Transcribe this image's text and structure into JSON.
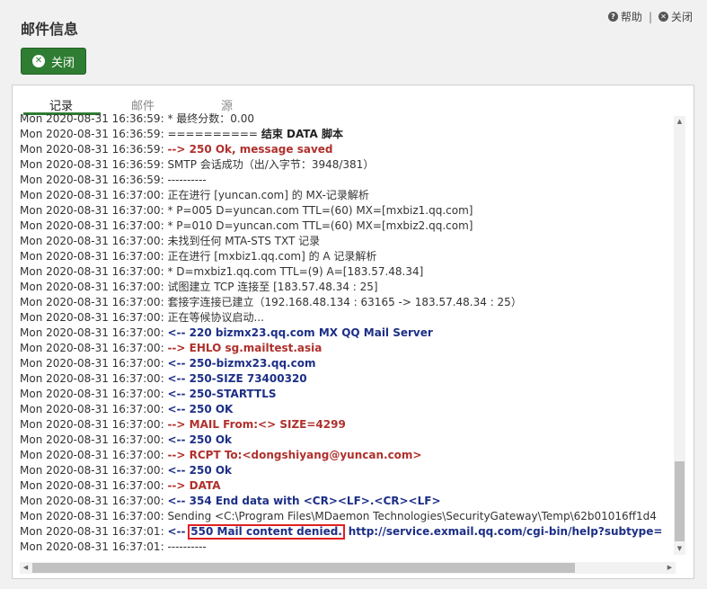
{
  "dialog": {
    "title": "邮件信息"
  },
  "top_links": {
    "help": "帮助",
    "close": "关闭",
    "separator": "|"
  },
  "close_button": {
    "label": "关闭"
  },
  "tabs": [
    {
      "label": "记录",
      "active": true
    },
    {
      "label": "邮件",
      "active": false
    },
    {
      "label": "源",
      "active": false
    }
  ],
  "log_lines": [
    {
      "time": "Mon 2020-08-31 16:36:59:",
      "msg": "* 最终分数：0.00",
      "style": "plain"
    },
    {
      "time": "Mon 2020-08-31 16:36:59:",
      "msg": "==========",
      "extra": "结束 DATA 脚本",
      "style": "mixed"
    },
    {
      "time": "Mon 2020-08-31 16:36:59:",
      "msg": "--> 250 Ok, message saved",
      "style": "out"
    },
    {
      "time": "Mon 2020-08-31 16:36:59:",
      "msg": "SMTP 会话成功（出/入字节：3948/381）",
      "style": "plain"
    },
    {
      "time": "Mon 2020-08-31 16:36:59:",
      "msg": "----------",
      "style": "plain"
    },
    {
      "time": "Mon 2020-08-31 16:37:00:",
      "msg": "正在进行 [yuncan.com] 的 MX-记录解析",
      "style": "plain"
    },
    {
      "time": "Mon 2020-08-31 16:37:00:",
      "msg": "* P=005 D=yuncan.com TTL=(60) MX=[mxbiz1.qq.com]",
      "style": "plain"
    },
    {
      "time": "Mon 2020-08-31 16:37:00:",
      "msg": "* P=010 D=yuncan.com TTL=(60) MX=[mxbiz2.qq.com]",
      "style": "plain"
    },
    {
      "time": "Mon 2020-08-31 16:37:00:",
      "msg": "未找到任何 MTA-STS TXT 记录",
      "style": "plain"
    },
    {
      "time": "Mon 2020-08-31 16:37:00:",
      "msg": "正在进行 [mxbiz1.qq.com] 的 A 记录解析",
      "style": "plain"
    },
    {
      "time": "Mon 2020-08-31 16:37:00:",
      "msg": "* D=mxbiz1.qq.com TTL=(9) A=[183.57.48.34]",
      "style": "plain"
    },
    {
      "time": "Mon 2020-08-31 16:37:00:",
      "msg": "试图建立 TCP 连接至 [183.57.48.34 : 25]",
      "style": "plain"
    },
    {
      "time": "Mon 2020-08-31 16:37:00:",
      "msg": "套接字连接已建立（192.168.48.134 : 63165 -> 183.57.48.34 : 25）",
      "style": "plain"
    },
    {
      "time": "Mon 2020-08-31 16:37:00:",
      "msg": "正在等候协议启动...",
      "style": "plain"
    },
    {
      "time": "Mon 2020-08-31 16:37:00:",
      "msg": "<-- 220 bizmx23.qq.com MX QQ Mail Server",
      "style": "in"
    },
    {
      "time": "Mon 2020-08-31 16:37:00:",
      "msg": "--> EHLO sg.mailtest.asia",
      "style": "out"
    },
    {
      "time": "Mon 2020-08-31 16:37:00:",
      "msg": "<-- 250-bizmx23.qq.com",
      "style": "in"
    },
    {
      "time": "Mon 2020-08-31 16:37:00:",
      "msg": "<-- 250-SIZE 73400320",
      "style": "in"
    },
    {
      "time": "Mon 2020-08-31 16:37:00:",
      "msg": "<-- 250-STARTTLS",
      "style": "in"
    },
    {
      "time": "Mon 2020-08-31 16:37:00:",
      "msg": "<-- 250 OK",
      "style": "in"
    },
    {
      "time": "Mon 2020-08-31 16:37:00:",
      "msg": "--> MAIL From:<> SIZE=4299",
      "style": "out"
    },
    {
      "time": "Mon 2020-08-31 16:37:00:",
      "msg": "<-- 250 Ok",
      "style": "in"
    },
    {
      "time": "Mon 2020-08-31 16:37:00:",
      "msg": "--> RCPT To:<dongshiyang@yuncan.com>",
      "style": "out"
    },
    {
      "time": "Mon 2020-08-31 16:37:00:",
      "msg": "<-- 250 Ok",
      "style": "in"
    },
    {
      "time": "Mon 2020-08-31 16:37:00:",
      "msg": "--> DATA",
      "style": "out"
    },
    {
      "time": "Mon 2020-08-31 16:37:00:",
      "msg": "<-- 354 End data with <CR><LF>.<CR><LF>",
      "style": "in"
    },
    {
      "time": "Mon 2020-08-31 16:37:00:",
      "msg": "Sending <C:\\Program Files\\MDaemon Technologies\\SecurityGateway\\Temp\\62b01016ff1d4",
      "style": "plain"
    },
    {
      "time": "Mon 2020-08-31 16:37:01:",
      "msg": "<--",
      "highlight": "550 Mail content denied.",
      "extra": "http://service.exmail.qq.com/cgi-bin/help?subtype=",
      "style": "denied"
    },
    {
      "time": "Mon 2020-08-31 16:37:01:",
      "msg": "----------",
      "style": "plain"
    }
  ],
  "colors": {
    "accent": "#2e7d32",
    "outgoing": "#b0302c",
    "incoming": "#1c2f86",
    "highlight_box": "#e02020"
  },
  "icons": {
    "help": "question-circle-icon",
    "close": "times-circle-icon"
  }
}
